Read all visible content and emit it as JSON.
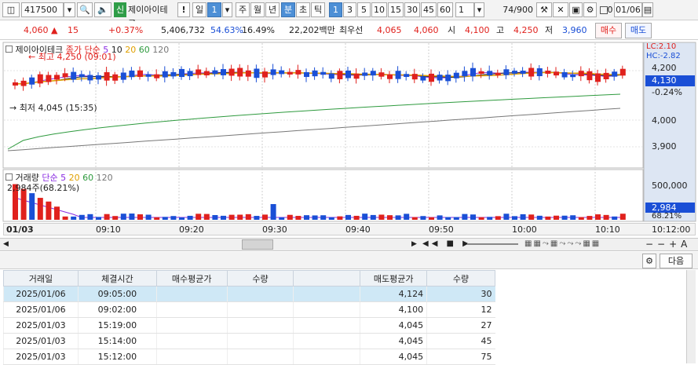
{
  "toolbar": {
    "code": "417500",
    "credit_badge": "신",
    "stock_name": "제이아이테크",
    "alert": "!",
    "period_daily": "일",
    "period_num": "1",
    "period_weekly": "주",
    "period_monthly": "월",
    "period_yearly": "년",
    "period_minute": "분",
    "period_second": "초",
    "period_tick": "틱",
    "intervals": [
      "1",
      "3",
      "5",
      "10",
      "15",
      "30",
      "45",
      "60"
    ],
    "interval_select": "1",
    "count": "74",
    "count_total": "/900",
    "date_checkbox_label": "0",
    "date": "01/06"
  },
  "quote": {
    "price": "4,060",
    "change": "15",
    "change_pct": "+0.37%",
    "volume": "5,406,732",
    "ratio1": "54.63%",
    "ratio2": "16.49%",
    "amount": "22,202백만",
    "best_bid_label": "최우선",
    "best_ask": "4,065",
    "best_bid": "4,060",
    "open_label": "시",
    "open": "4,100",
    "high_label": "고",
    "high": "4,250",
    "low_label": "저",
    "low": "3,960",
    "buy_button": "매수",
    "sell_button": "매도"
  },
  "chart": {
    "legend_name": "제이아이테크",
    "legend_close": "종가 단순",
    "ma_periods": [
      "5",
      "10",
      "20",
      "60",
      "120"
    ],
    "high_marker": "최고 4,250 (09:01)",
    "low_marker": "최저 4,045 (15:35)",
    "lc_label": "LC:2.10",
    "hc_label": "HC:-2.82",
    "price_axis": [
      "4,200",
      "4,000",
      "3,900"
    ],
    "current_price_tag": "4,130",
    "current_pct_tag": "-0.24%",
    "volume_legend": "거래량",
    "volume_ma_label": "단순",
    "volume_ma_periods": [
      "5",
      "20",
      "60",
      "120"
    ],
    "volume_info": "2,984주(68.21%)",
    "volume_axis": "500,000",
    "volume_tag": "2,984",
    "volume_pct_tag": "68.21%",
    "date_label": "01/03",
    "time_ticks": [
      "09:10",
      "09:20",
      "09:30",
      "09:40",
      "09:50",
      "10:00",
      "10:10"
    ],
    "time_axis_end": "10:12:00",
    "colors": {
      "up": "#e0211d",
      "down": "#1a4fd6",
      "ma5": "#8a2be2",
      "ma10": "#222222",
      "ma20": "#e0a000",
      "ma60": "#2e9a3e",
      "ma120": "#777777"
    }
  },
  "gridbar": {
    "next_button": "다음"
  },
  "table": {
    "headers": [
      "거래일",
      "체결시간",
      "매수평균가",
      "수량",
      "",
      "매도평균가",
      "수량"
    ],
    "rows": [
      [
        "2025/01/06",
        "09:05:00",
        "",
        "",
        "",
        "4,124",
        "30"
      ],
      [
        "2025/01/06",
        "09:02:00",
        "",
        "",
        "",
        "4,100",
        "12"
      ],
      [
        "2025/01/03",
        "15:19:00",
        "",
        "",
        "",
        "4,045",
        "27"
      ],
      [
        "2025/01/03",
        "15:14:00",
        "",
        "",
        "",
        "4,045",
        "45"
      ],
      [
        "2025/01/03",
        "15:12:00",
        "",
        "",
        "",
        "4,045",
        "75"
      ]
    ]
  }
}
